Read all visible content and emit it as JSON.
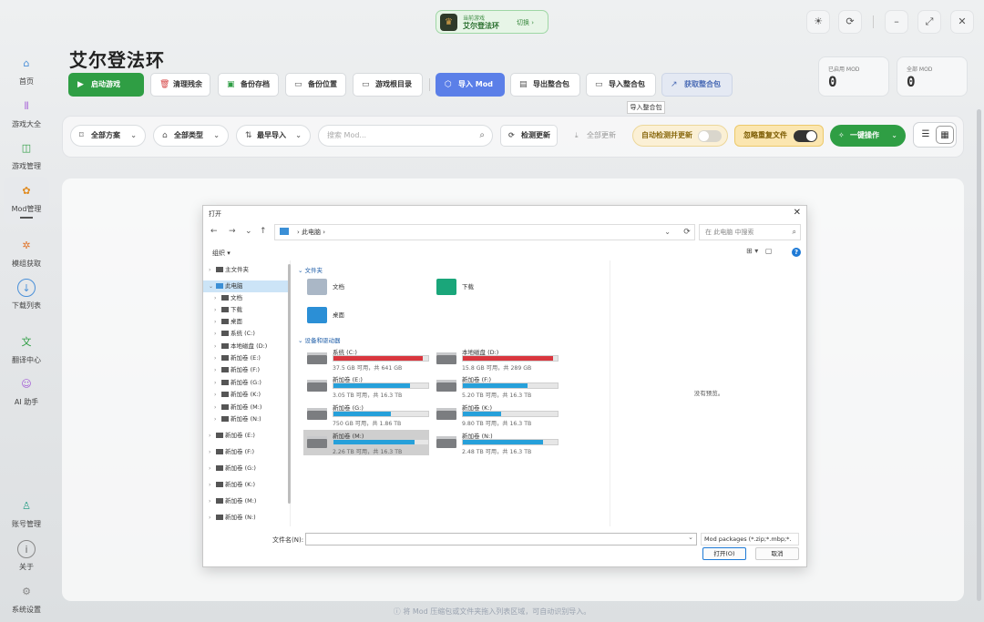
{
  "game_chip": {
    "subtitle": "当前游戏",
    "name": "艾尔登法环",
    "switch_label": "切换 ›"
  },
  "window_controls": {
    "theme": "☀",
    "refresh": "⟳",
    "minimize": "–",
    "maximize": "⤢",
    "close": "✕"
  },
  "sidebar": {
    "items": [
      {
        "label": "首页",
        "icon": "home-icon"
      },
      {
        "label": "游戏大全",
        "icon": "library-icon"
      },
      {
        "label": "游戏管理",
        "icon": "gamepad-icon"
      },
      {
        "label": "Mod管理",
        "icon": "mod-icon"
      },
      {
        "label": "模组获取",
        "icon": "pinwheel-icon"
      },
      {
        "label": "下载列表",
        "icon": "download-icon"
      },
      {
        "label": "翻译中心",
        "icon": "translate-icon"
      },
      {
        "label": "AI 助手",
        "icon": "robot-icon"
      },
      {
        "label": "账号管理",
        "icon": "user-icon"
      },
      {
        "label": "关于",
        "icon": "info-icon"
      },
      {
        "label": "系统设置",
        "icon": "gear-icon"
      }
    ]
  },
  "page": {
    "title": "艾尔登法环",
    "actions": {
      "launch": "启动游戏",
      "clean": "清理残余",
      "backup_save": "备份存档",
      "backup_location": "备份位置",
      "game_root": "游戏根目录",
      "import_mod": "导入 Mod",
      "export_pack": "导出整合包",
      "import_pack": "导入整合包",
      "get_pack": "获取整合包"
    },
    "tooltip": "导入整合包",
    "stats": {
      "enabled_label": "已启用 MOD",
      "enabled_value": "0",
      "total_label": "全部 MOD",
      "total_value": "0"
    }
  },
  "toolbar": {
    "scheme": "全部方案",
    "type": "全部类型",
    "sort": "最早导入",
    "search_placeholder": "搜索 Mod...",
    "check_update": "检测更新",
    "update_all": "全部更新",
    "auto_check": "自动检测并更新",
    "ignore_dup": "忽略重复文件",
    "one_click": "一键操作"
  },
  "hint": "将 Mod 压缩包或文件夹拖入列表区域，可自动识别导入。",
  "dialog": {
    "title": "打开",
    "address": "此电脑",
    "search_placeholder": "在 此电脑 中搜索",
    "organize": "组织 ▾",
    "tree": [
      {
        "label": "主文件夹",
        "level": 0
      },
      {
        "label": "此电脑",
        "level": 0,
        "selected": true
      },
      {
        "label": "文档",
        "level": 1
      },
      {
        "label": "下载",
        "level": 1
      },
      {
        "label": "桌面",
        "level": 1
      },
      {
        "label": "系统 (C:)",
        "level": 1
      },
      {
        "label": "本地磁盘 (D:)",
        "level": 1
      },
      {
        "label": "新加卷 (E:)",
        "level": 1
      },
      {
        "label": "新加卷 (F:)",
        "level": 1
      },
      {
        "label": "新加卷 (G:)",
        "level": 1
      },
      {
        "label": "新加卷 (K:)",
        "level": 1
      },
      {
        "label": "新加卷 (M:)",
        "level": 1
      },
      {
        "label": "新加卷 (N:)",
        "level": 1
      },
      {
        "label": "新加卷 (E:)",
        "level": 0
      },
      {
        "label": "新加卷 (F:)",
        "level": 0
      },
      {
        "label": "新加卷 (G:)",
        "level": 0
      },
      {
        "label": "新加卷 (K:)",
        "level": 0
      },
      {
        "label": "新加卷 (M:)",
        "level": 0
      },
      {
        "label": "新加卷 (N:)",
        "level": 0
      }
    ],
    "folders_header": "文件夹",
    "folders": [
      "文档",
      "下载",
      "桌面"
    ],
    "drives_header": "设备和驱动器",
    "drives": [
      {
        "name": "系统 (C:)",
        "size": "37.5 GB 可用，共 641 GB",
        "used": 0.94,
        "color": "#d9363e"
      },
      {
        "name": "本地磁盘 (D:)",
        "size": "15.8 GB 可用，共 289 GB",
        "used": 0.95,
        "color": "#d9363e"
      },
      {
        "name": "新加卷 (E:)",
        "size": "3.05 TB 可用，共 16.3 TB",
        "used": 0.81,
        "color": "#26a0da"
      },
      {
        "name": "新加卷 (F:)",
        "size": "5.20 TB 可用，共 16.3 TB",
        "used": 0.68,
        "color": "#26a0da"
      },
      {
        "name": "新加卷 (G:)",
        "size": "750 GB 可用，共 1.86 TB",
        "used": 0.61,
        "color": "#26a0da"
      },
      {
        "name": "新加卷 (K:)",
        "size": "9.80 TB 可用，共 16.3 TB",
        "used": 0.4,
        "color": "#26a0da"
      },
      {
        "name": "新加卷 (M:)",
        "size": "2.26 TB 可用，共 16.3 TB",
        "used": 0.86,
        "color": "#26a0da",
        "selected": true
      },
      {
        "name": "新加卷 (N:)",
        "size": "2.48 TB 可用，共 16.3 TB",
        "used": 0.85,
        "color": "#26a0da"
      }
    ],
    "preview_text": "没有预览。",
    "filename_label": "文件名(N):",
    "file_type": "Mod packages (*.zip;*.mbp;*.",
    "open": "打开(O)",
    "cancel": "取消"
  }
}
